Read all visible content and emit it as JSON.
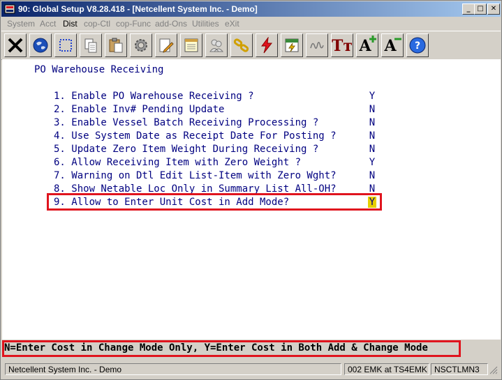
{
  "window": {
    "title": "90: Global Setup V8.28.418 - [Netcellent System Inc. - Demo]",
    "controls": [
      "_",
      "□",
      "✕"
    ]
  },
  "menu": [
    {
      "label": "System"
    },
    {
      "label": "Acct"
    },
    {
      "label": "Dist"
    },
    {
      "label": "cop-Ctl"
    },
    {
      "label": "cop-Func"
    },
    {
      "label": "add-Ons"
    },
    {
      "label": "Utilities"
    },
    {
      "label": "eXit"
    }
  ],
  "toolbar": {
    "icons": [
      "close-icon",
      "globe-icon",
      "select-icon",
      "copy-icon",
      "paste-icon",
      "settings-icon",
      "edit-icon",
      "notes-icon",
      "users-icon",
      "chain-icon",
      "lightning-icon",
      "calendar-icon",
      "signature-icon",
      "font-icon",
      "font-increase-icon",
      "font-decrease-icon",
      "help-icon"
    ],
    "font_label": "Tт",
    "font_increase_label": "A",
    "font_decrease_label": "A",
    "help_label": "?"
  },
  "screen": {
    "heading": "PO Warehouse Receiving",
    "options": [
      {
        "label": "1. Enable PO Warehouse Receiving ?",
        "value": "Y"
      },
      {
        "label": "2. Enable Inv# Pending Update",
        "value": "N"
      },
      {
        "label": "3. Enable Vessel Batch Receiving Processing ?",
        "value": "N"
      },
      {
        "label": "4. Use System Date as Receipt Date For Posting ?",
        "value": "N"
      },
      {
        "label": "5. Update Zero Item Weight During Receiving ?",
        "value": "N"
      },
      {
        "label": "6. Allow Receiving Item with Zero Weight ?",
        "value": "Y"
      },
      {
        "label": "7. Warning on Dtl Edit List-Item with Zero Wght?",
        "value": "N"
      },
      {
        "label": "8. Show Netable Loc Only in Summary List All-OH?",
        "value": "N"
      },
      {
        "label": "9. Allow to Enter Unit Cost in Add Mode?",
        "value": "Y"
      }
    ]
  },
  "help_text": "N=Enter Cost in Change Mode Only, Y=Enter Cost in Both Add & Change Mode",
  "status": {
    "company": "Netcellent System Inc. - Demo",
    "terminal": "002 EMK at TS4EMK",
    "code": "NSCTLMN3"
  },
  "colors": {
    "title_bar": "#0a246a",
    "screen_text": "#000080",
    "highlight_border": "#e0141e",
    "cursor": "#e6d000"
  }
}
